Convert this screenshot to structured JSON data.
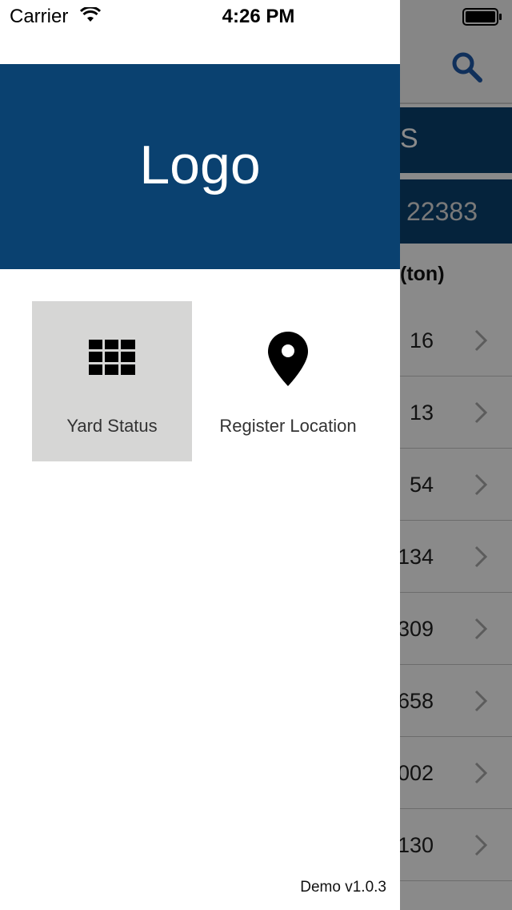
{
  "status_bar": {
    "carrier": "Carrier",
    "time": "4:26 PM"
  },
  "background": {
    "band1_text": "S",
    "band2_text": "22383",
    "column_header": "(ton)",
    "row_values": [
      "16",
      "13",
      "54",
      "134",
      "309",
      "658",
      "002",
      "130"
    ]
  },
  "drawer": {
    "logo": "Logo",
    "tiles": [
      {
        "label": "Yard Status",
        "icon": "grid-icon",
        "selected": true
      },
      {
        "label": "Register Location",
        "icon": "map-pin-icon",
        "selected": false
      }
    ],
    "version": "Demo v1.0.3"
  },
  "colors": {
    "brand_blue": "#0a4170",
    "tile_selected": "#d6d6d5",
    "search_icon_blue": "#1f5aa8"
  }
}
